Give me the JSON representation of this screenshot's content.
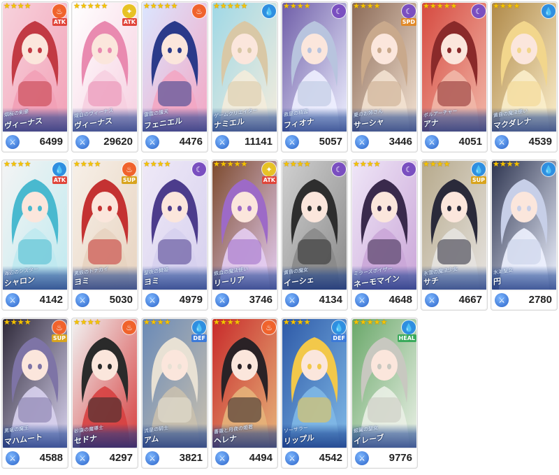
{
  "cards": [
    {
      "title": "烟桜の剣豪",
      "name": "ヴィーナス",
      "power": "6499",
      "stars": 4,
      "element": "fire",
      "role": "ATK",
      "palette": [
        "#c23a44",
        "#f2a0b6",
        "#f7d2dc"
      ]
    },
    {
      "title": "煌白のヴィーナス",
      "name": "ヴィーナス",
      "power": "29620",
      "stars": 5,
      "element": "light",
      "role": "ATK",
      "palette": [
        "#e98ab0",
        "#f6cfe0",
        "#ffffff"
      ]
    },
    {
      "title": "雷霆の護天",
      "name": "フェニエル",
      "power": "4476",
      "stars": 5,
      "element": "fire",
      "role": "",
      "palette": [
        "#2b3a8a",
        "#f3a6c3",
        "#dbe6ff"
      ]
    },
    {
      "title": "ゲームクリエイター",
      "name": "ナミエル",
      "power": "11141",
      "stars": 5,
      "element": "water",
      "role": "",
      "palette": [
        "#d9c8a6",
        "#f4ecdc",
        "#9fd8e6"
      ]
    },
    {
      "title": "救星の精霊",
      "name": "フィオナ",
      "power": "5057",
      "stars": 4,
      "element": "dark",
      "role": "",
      "palette": [
        "#b8c4de",
        "#eef0ff",
        "#6f5ea8"
      ]
    },
    {
      "title": "夏のお姉さん",
      "name": "サーシャ",
      "power": "3446",
      "stars": 4,
      "element": "dark",
      "role": "SPD",
      "palette": [
        "#c9a98c",
        "#f3e2d2",
        "#8c6b58"
      ]
    },
    {
      "title": "ボルアーチャー",
      "name": "アナ",
      "power": "4051",
      "stars": 5,
      "element": "dark",
      "role": "",
      "palette": [
        "#8a2a2a",
        "#f1b7a8",
        "#d64a40"
      ]
    },
    {
      "title": "黄昏の魔法使い",
      "name": "マクダレナ",
      "power": "4539",
      "stars": 4,
      "element": "water",
      "role": "",
      "palette": [
        "#f2d68c",
        "#fbeecb",
        "#b08a4a"
      ]
    },
    {
      "title": "海辺のシスター",
      "name": "シャロン",
      "power": "4142",
      "stars": 4,
      "element": "water",
      "role": "ATK",
      "palette": [
        "#49b9cf",
        "#bfe9ef",
        "#f4f4f4"
      ]
    },
    {
      "title": "黒鉄のトナカイ",
      "name": "ヨミ",
      "power": "5030",
      "stars": 4,
      "element": "fire",
      "role": "SUP",
      "palette": [
        "#c43232",
        "#e7d3c0",
        "#f7f0e8"
      ]
    },
    {
      "title": "聖夜の舞姫",
      "name": "ヨミ",
      "power": "4979",
      "stars": 4,
      "element": "dark",
      "role": "",
      "palette": [
        "#4c3c8c",
        "#d6d0ee",
        "#efe9f7"
      ]
    },
    {
      "title": "鉄血の魔法使い",
      "name": "リーリア",
      "power": "3746",
      "stars": 5,
      "element": "light",
      "role": "ATK",
      "palette": [
        "#9d6ac7",
        "#e4cdf2",
        "#7d4b2e"
      ]
    },
    {
      "title": "黄昏の魔女",
      "name": "イーシェ",
      "power": "4134",
      "stars": 4,
      "element": "dark",
      "role": "",
      "palette": [
        "#2e2e2e",
        "#8a8a8a",
        "#d0d0d0"
      ]
    },
    {
      "title": "ミラーズポイザー",
      "name": "ネーモマイン",
      "power": "4648",
      "stars": 4,
      "element": "dark",
      "role": "",
      "palette": [
        "#3a2a4c",
        "#caa6d8",
        "#efe6f7"
      ]
    },
    {
      "title": "氷雪の魔法少女",
      "name": "サチ",
      "power": "4667",
      "stars": 4,
      "element": "water",
      "role": "SUP",
      "palette": [
        "#2a2a3a",
        "#e6e3e0",
        "#b7aa8c"
      ]
    },
    {
      "title": "氷湖聖女",
      "name": "円",
      "power": "2780",
      "stars": 4,
      "element": "water",
      "role": "",
      "palette": [
        "#c7cfe8",
        "#eef2ff",
        "#2e3550"
      ]
    },
    {
      "title": "黒竜の魔王",
      "name": "マハムート",
      "power": "4588",
      "stars": 4,
      "element": "fire",
      "role": "SUP",
      "palette": [
        "#7e74a6",
        "#d8d2ee",
        "#2f2a3a"
      ]
    },
    {
      "title": "砂漠の魔導士",
      "name": "セドナ",
      "power": "4297",
      "stars": 4,
      "element": "fire",
      "role": "",
      "palette": [
        "#2a2a2a",
        "#d64040",
        "#f1f1f1"
      ]
    },
    {
      "title": "流星の騎士",
      "name": "アム",
      "power": "3821",
      "stars": 4,
      "element": "water",
      "role": "DEF",
      "palette": [
        "#e8e1d4",
        "#c9c0ae",
        "#6a8ab7"
      ]
    },
    {
      "title": "薔薇と月夜の姫君",
      "name": "ヘレナ",
      "power": "4494",
      "stars": 4,
      "element": "fire",
      "role": "",
      "palette": [
        "#2a2226",
        "#e6b37a",
        "#c82a2a"
      ]
    },
    {
      "title": "ソーサラー",
      "name": "リップル",
      "power": "4542",
      "stars": 4,
      "element": "water",
      "role": "DEF",
      "palette": [
        "#f2c84a",
        "#7fb8e6",
        "#2e5aa8"
      ]
    },
    {
      "title": "銀翼の聖女",
      "name": "イレーブ",
      "power": "9776",
      "stars": 5,
      "element": "water",
      "role": "HEAL",
      "palette": [
        "#c8c8c0",
        "#eaf0e6",
        "#6aa86a"
      ]
    }
  ],
  "star_glyph": "★",
  "power_icon": "sword-icon",
  "element_colors": {
    "fire": "#f0632c",
    "water": "#2f8fe0",
    "dark": "#7a4fc0",
    "light": "#e7c226"
  },
  "element_glyphs": {
    "fire": "♨",
    "water": "💧",
    "dark": "☾",
    "light": "✦"
  },
  "role_colors": {
    "ATK": "#e0453a",
    "SPD": "#e08a2a",
    "SUP": "#d8a41e",
    "DEF": "#3c7ad8",
    "HEAL": "#3aaa5c"
  }
}
